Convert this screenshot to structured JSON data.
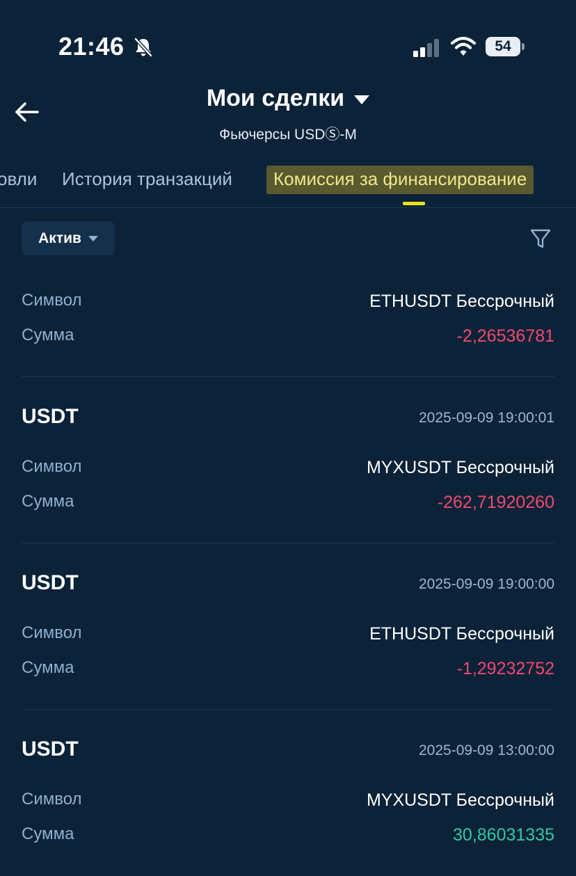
{
  "status_bar": {
    "time": "21:46",
    "battery": "54"
  },
  "header": {
    "title": "Мои сделки",
    "subtitle": "Фьючерсы USDⓈ-M"
  },
  "tabs": [
    {
      "label": "овли",
      "active": false
    },
    {
      "label": "История транзакций",
      "active": false
    },
    {
      "label": "Комиссия за финансирование",
      "active": true
    }
  ],
  "filter": {
    "asset_label": "Актив"
  },
  "labels": {
    "symbol": "Символ",
    "amount": "Сумма"
  },
  "records": [
    {
      "currency": "",
      "datetime": "",
      "symbol": "ETHUSDT Бессрочный",
      "amount": "-2,26536781",
      "sign": "negative"
    },
    {
      "currency": "USDT",
      "datetime": "2025-09-09 19:00:01",
      "symbol": "MYXUSDT Бессрочный",
      "amount": "-262,71920260",
      "sign": "negative"
    },
    {
      "currency": "USDT",
      "datetime": "2025-09-09 19:00:00",
      "symbol": "ETHUSDT Бессрочный",
      "amount": "-1,29232752",
      "sign": "negative"
    },
    {
      "currency": "USDT",
      "datetime": "2025-09-09 13:00:00",
      "symbol": "MYXUSDT Бессрочный",
      "amount": "30,86031335",
      "sign": "positive"
    }
  ],
  "colors": {
    "background": "#0b2238",
    "negative": "#ef4a6f",
    "positive": "#2ec9a5",
    "active_tab_highlight": "#f0e11b"
  },
  "icons": [
    "bell-off-icon",
    "cellular-signal-icon",
    "wifi-icon",
    "battery-icon",
    "back-arrow-icon",
    "caret-down-icon",
    "filter-icon"
  ]
}
